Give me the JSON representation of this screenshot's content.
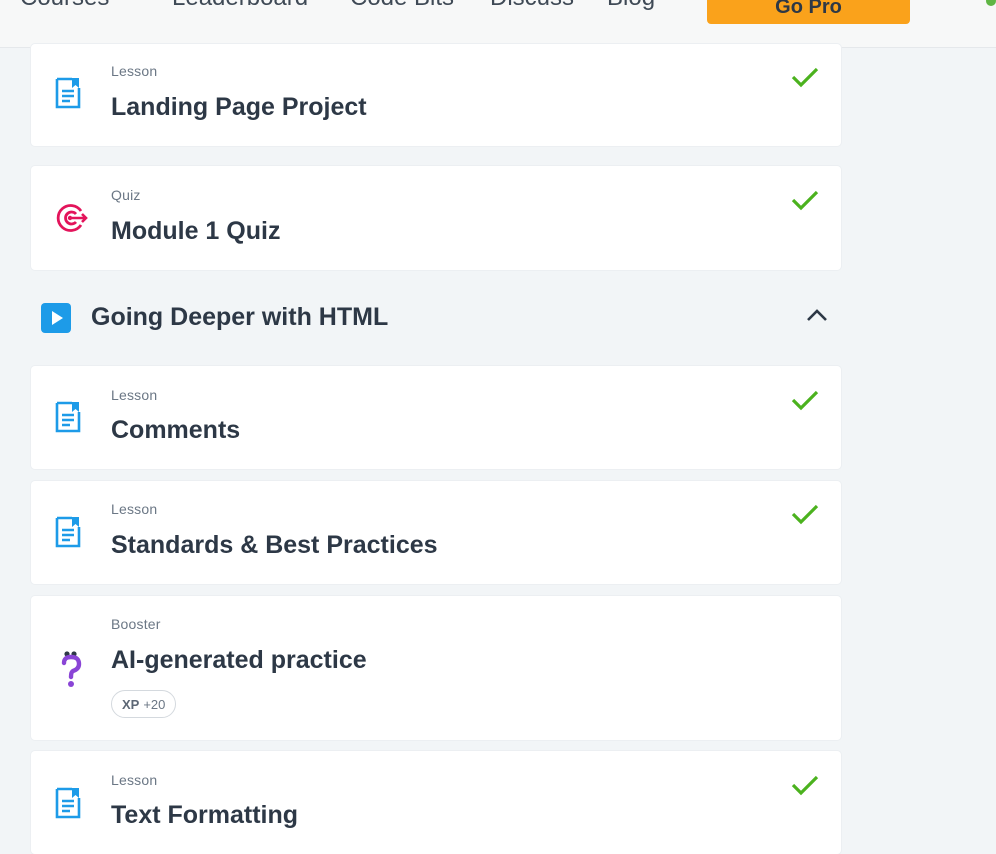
{
  "nav": {
    "items": [
      "Courses",
      "Leaderboard",
      "Code Bits",
      "Discuss",
      "Blog"
    ],
    "cta": "Go Pro"
  },
  "cards_top": [
    {
      "kind": "Lesson",
      "title": "Landing Page Project",
      "icon": "lesson-doc-icon",
      "completed": true
    },
    {
      "kind": "Quiz",
      "title": "Module 1 Quiz",
      "icon": "target-icon",
      "completed": true
    }
  ],
  "section": {
    "title": "Going Deeper with HTML",
    "icon": "play-icon",
    "expanded": true
  },
  "cards_bottom": [
    {
      "kind": "Lesson",
      "title": "Comments",
      "icon": "lesson-doc-icon",
      "completed": true
    },
    {
      "kind": "Lesson",
      "title": "Standards & Best Practices",
      "icon": "lesson-doc-icon",
      "completed": true
    },
    {
      "kind": "Booster",
      "title": "AI-generated practice",
      "icon": "question-mark-icon",
      "completed": false,
      "xp_label": "XP",
      "xp_value": "+20"
    },
    {
      "kind": "Lesson",
      "title": "Text Formatting",
      "icon": "lesson-doc-icon",
      "completed": true
    }
  ],
  "colors": {
    "accent_blue": "#1d9be8",
    "check_green": "#4bb21e",
    "quiz_pink": "#e3145b",
    "booster_purple": "#8a45d6",
    "pro_orange": "#faa21b"
  }
}
